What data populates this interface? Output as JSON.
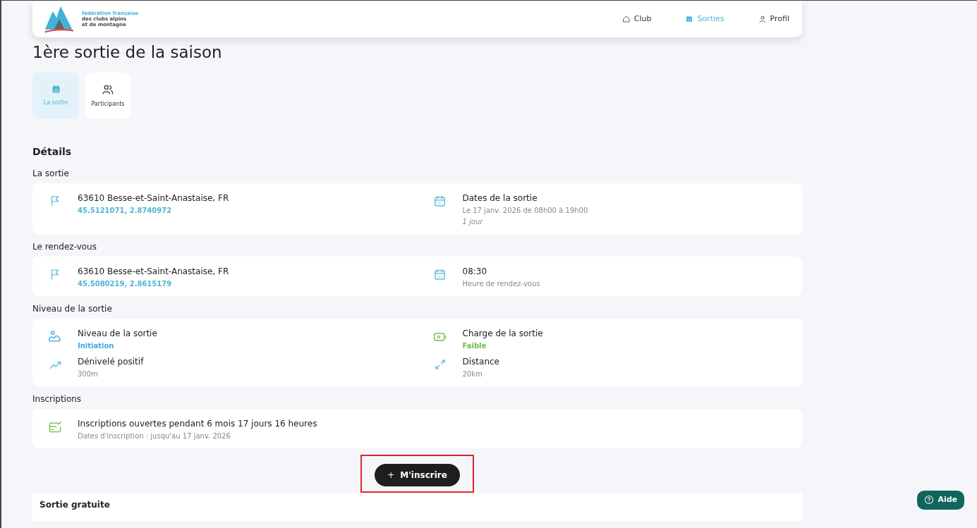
{
  "logo": {
    "lines": [
      "fédération française",
      "des clubs alpins",
      "et de montagne"
    ]
  },
  "nav": [
    {
      "label": "Club",
      "selected": false
    },
    {
      "label": "Sorties",
      "selected": true
    },
    {
      "label": "Profil",
      "selected": false
    }
  ],
  "title": "1ère sortie de la saison",
  "tabs": [
    {
      "label": "La sortie",
      "selected": true
    },
    {
      "label": "Participants",
      "selected": false
    }
  ],
  "details_heading": "Détails",
  "sections": [
    {
      "heading": "La sortie",
      "items": [
        {
          "label": "63610 Besse-et-Saint-Anastaise, FR",
          "values": [
            {
              "text": "45.5121071, 2.8740972",
              "color": "#4fb6d6"
            }
          ]
        },
        {
          "label": "Dates de la sortie",
          "values": [
            {
              "text": "Le 17 janv. 2026 de 08h00 à 19h00"
            },
            {
              "text": "1 jour",
              "italic": true
            }
          ]
        }
      ]
    },
    {
      "heading": "Le rendez-vous",
      "items": [
        {
          "label": "63610 Besse-et-Saint-Anastaise, FR",
          "values": [
            {
              "text": "45.5080219, 2.8615179",
              "color": "#4fb6d6"
            }
          ]
        },
        {
          "label": "08:30",
          "values": [
            {
              "text": "Heure de rendez-vous"
            }
          ]
        }
      ]
    },
    {
      "heading": "Niveau de la sortie",
      "items": [
        {
          "label": "Niveau de la sortie",
          "values": [
            {
              "text": "Initiation",
              "color": "#3aa8e6"
            }
          ]
        },
        {
          "label": "Charge de la sortie",
          "values": [
            {
              "text": "Faible",
              "color": "#6cc04a"
            }
          ]
        },
        {
          "label": "Dénivelé positif",
          "values": [
            {
              "text": "300m"
            }
          ]
        },
        {
          "label": "Distance",
          "values": [
            {
              "text": "20km"
            }
          ]
        }
      ]
    },
    {
      "heading": "Inscriptions",
      "items": [
        {
          "label": "Inscriptions ouvertes pendant 6 mois 17 jours 16 heures",
          "values": [
            {
              "text": "Dates d'inscription : jusqu'au 17 janv. 2026"
            }
          ]
        }
      ]
    }
  ],
  "register_button": {
    "icon": "+",
    "label": "M'inscrire",
    "highlighted": true
  },
  "price_card": {
    "label": "Sortie gratuite"
  },
  "help_button": {
    "label": "Aide"
  }
}
